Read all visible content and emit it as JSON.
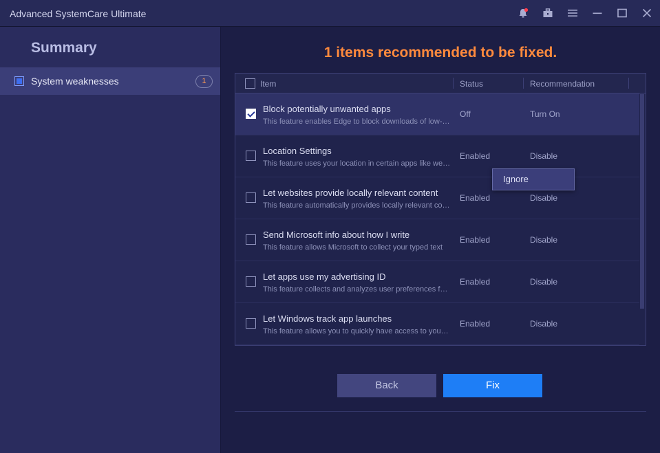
{
  "window": {
    "title": "Advanced SystemCare Ultimate",
    "controls": [
      "bell-icon",
      "toolbox-icon",
      "menu-icon",
      "minimize-icon",
      "maximize-icon",
      "close-icon"
    ]
  },
  "sidebar": {
    "title": "Summary",
    "items": [
      {
        "label": "System weaknesses",
        "count": "1"
      }
    ]
  },
  "main": {
    "headline": "1 items recommended to be fixed.",
    "table": {
      "columns": [
        "Item",
        "Status",
        "Recommendation"
      ],
      "rows": [
        {
          "title": "Block potentially unwanted apps",
          "desc": "This feature enables Edge to block downloads of low-reputation apps",
          "status": "Off",
          "recommendation": "Turn On",
          "checked": true
        },
        {
          "title": "Location Settings",
          "desc": "This feature uses your location in certain apps like weather",
          "status": "Enabled",
          "recommendation": "Disable",
          "checked": false
        },
        {
          "title": "Let websites provide locally relevant content",
          "desc": "This feature automatically provides locally relevant content",
          "status": "Enabled",
          "recommendation": "Disable",
          "checked": false
        },
        {
          "title": "Send Microsoft info about how I write",
          "desc": "This feature allows Microsoft to collect your typed text",
          "status": "Enabled",
          "recommendation": "Disable",
          "checked": false
        },
        {
          "title": "Let apps use my advertising ID",
          "desc": "This feature collects and analyzes user preferences for ads",
          "status": "Enabled",
          "recommendation": "Disable",
          "checked": false
        },
        {
          "title": "Let Windows track app launches",
          "desc": "This feature allows you to quickly have access to your apps",
          "status": "Enabled",
          "recommendation": "Disable",
          "checked": false
        }
      ]
    },
    "context_menu": {
      "ignore_label": "Ignore"
    },
    "buttons": {
      "back": "Back",
      "fix": "Fix"
    }
  },
  "colors": {
    "accent": "#1e7ef6",
    "headline": "#ff8a3d",
    "badge_count": "#ff9a52",
    "notification_dot": "#ff3b4a"
  }
}
